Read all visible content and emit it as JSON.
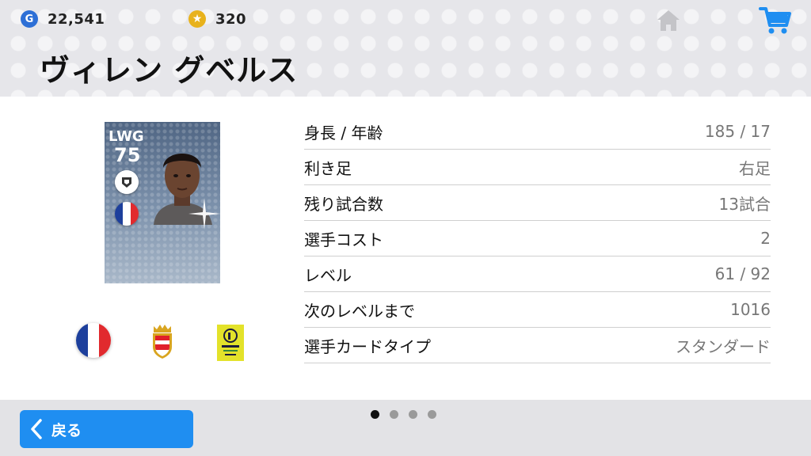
{
  "header": {
    "gp": {
      "icon": "gp-coin-icon",
      "letter": "G",
      "amount": "22,541"
    },
    "coins": {
      "icon": "star-coin-icon",
      "amount": "320"
    },
    "home_icon": "home-icon",
    "cart_icon": "cart-icon",
    "player_name": "ヴィレン グベルス"
  },
  "card": {
    "position": "LWG",
    "rating": "75",
    "bg_color": "#6a7f9b"
  },
  "badges": [
    "france-flag-icon",
    "as-monaco-crest-icon",
    "ligue-1-logo-icon"
  ],
  "info_rows": [
    {
      "label": "身長 / 年齢",
      "value": "185 / 17"
    },
    {
      "label": "利き足",
      "value": "右足"
    },
    {
      "label": "残り試合数",
      "value": "13試合"
    },
    {
      "label": "選手コスト",
      "value": "2"
    },
    {
      "label": "レベル",
      "value": "61 / 92"
    },
    {
      "label": "次のレベルまで",
      "value": "1016"
    },
    {
      "label": "選手カードタイプ",
      "value": "スタンダード"
    }
  ],
  "footer": {
    "back_label": "戻る",
    "page_indicator": {
      "total": 4,
      "current": 1
    }
  },
  "colors": {
    "accent": "#1f8ef1",
    "header_bg": "#e6e6ea",
    "gp_blue": "#2d6fd6",
    "coin_gold": "#e8b21c"
  }
}
